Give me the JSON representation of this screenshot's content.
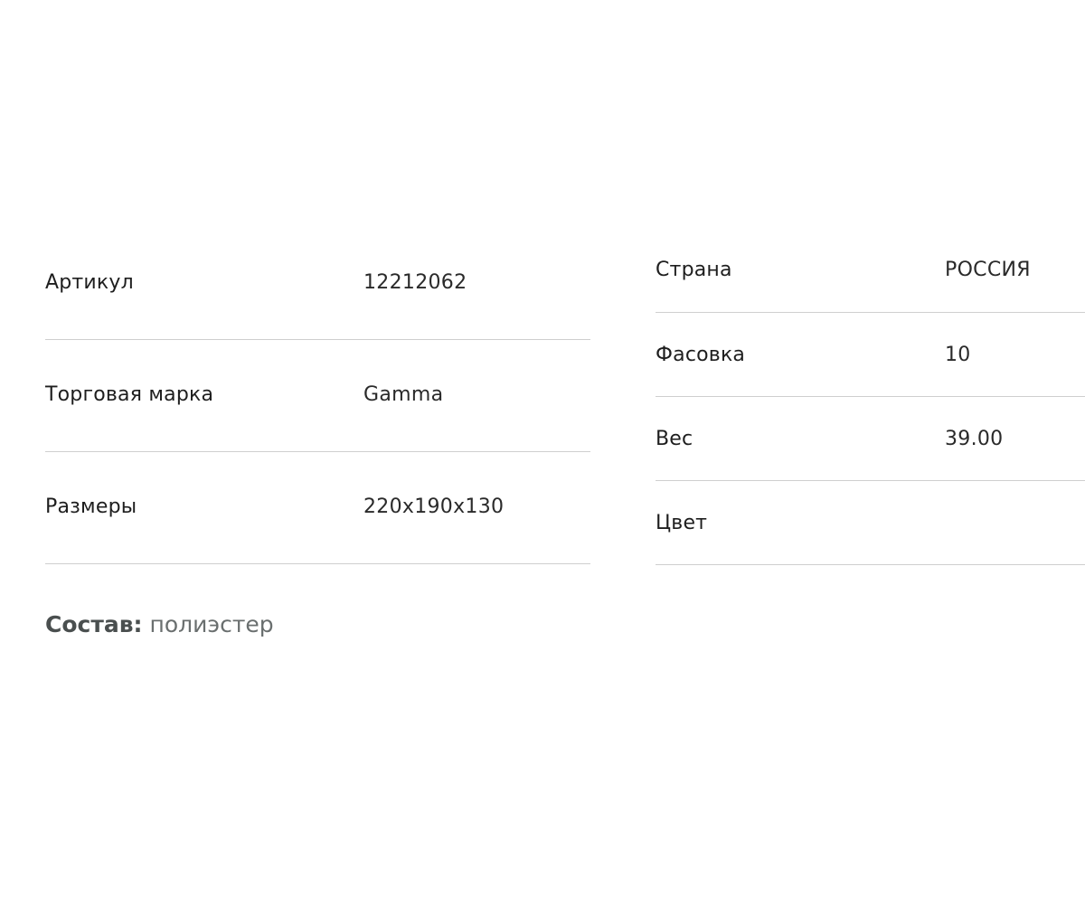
{
  "specs_left": [
    {
      "label": "Артикул",
      "value": "12212062"
    },
    {
      "label": "Торговая марка",
      "value": "Gamma"
    },
    {
      "label": "Размеры",
      "value": "220x190x130"
    }
  ],
  "specs_right": [
    {
      "label": "Страна",
      "value": "РОССИЯ"
    },
    {
      "label": "Фасовка",
      "value": "10"
    },
    {
      "label": "Вес",
      "value": "39.00"
    },
    {
      "label": "Цвет",
      "value": ""
    }
  ],
  "composition": {
    "label": "Состав:",
    "value": "полиэстер"
  },
  "colors": {
    "divider": "#cfcfcf",
    "text": "#1e1e1e",
    "muted": "#6a6f6f"
  }
}
